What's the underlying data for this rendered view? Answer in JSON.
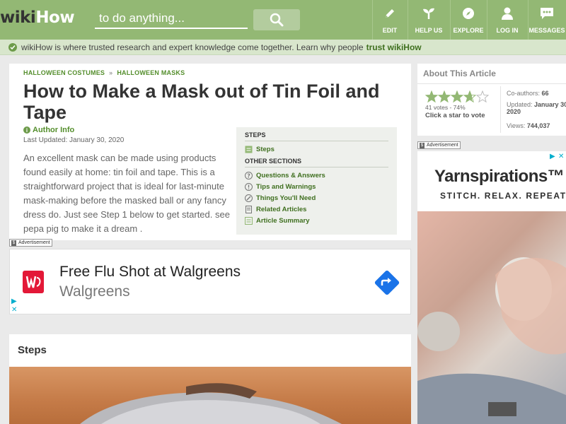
{
  "header": {
    "logo_wiki": "wiki",
    "logo_how": "How",
    "search_placeholder": "to do anything...",
    "nav": [
      {
        "label": "EDIT",
        "icon": "pencil-icon"
      },
      {
        "label": "HELP US",
        "icon": "sprout-icon"
      },
      {
        "label": "EXPLORE",
        "icon": "compass-icon"
      },
      {
        "label": "LOG IN",
        "icon": "user-icon"
      },
      {
        "label": "MESSAGES",
        "icon": "chat-icon"
      }
    ],
    "colors": {
      "bar": "#93b874",
      "search_button": "#b3cc9e"
    }
  },
  "trust_banner": {
    "text": "wikiHow is where trusted research and expert knowledge come together. Learn why people",
    "link": "trust wikiHow"
  },
  "article": {
    "breadcrumbs": [
      "HALLOWEEN COSTUMES",
      "HALLOWEEN MASKS"
    ],
    "breadcrumb_sep": "»",
    "title": "How to Make a Mask out of Tin Foil and Tape",
    "author_label": "Author Info",
    "last_updated": "Last Updated: January 30, 2020",
    "intro": "An excellent mask can be made using products found easily at home: tin foil and tape. This is a straightforward project that is ideal for last-minute mask-making before the masked ball or any fancy dress do. Just see Step 1 below to get started. see pepa pig to make it a dream ."
  },
  "toc": {
    "steps_heading": "STEPS",
    "steps_items": [
      {
        "label": "Steps",
        "icon": "list-icon"
      }
    ],
    "other_heading": "OTHER SECTIONS",
    "other_items": [
      {
        "label": "Questions & Answers",
        "icon": "question-icon"
      },
      {
        "label": "Tips and Warnings",
        "icon": "warning-icon"
      },
      {
        "label": "Things You'll Need",
        "icon": "tools-icon"
      },
      {
        "label": "Related Articles",
        "icon": "document-icon"
      },
      {
        "label": "Article Summary",
        "icon": "summary-icon"
      }
    ]
  },
  "ads": {
    "badge": "Advertisement",
    "flu": {
      "title": "Free Flu Shot at Walgreens",
      "sponsor": "Walgreens",
      "brand_color": "#e31837",
      "arrow_color": "#1a73e8"
    },
    "yarn": {
      "logo": "Yarnspirations™",
      "tagline": "STITCH. RELAX. REPEAT."
    }
  },
  "steps_section": {
    "title": "Steps"
  },
  "about": {
    "title": "About This Article",
    "rating_percent": 74,
    "votes": "41 votes - 74%",
    "click_prompt": "Click a star to vote",
    "coauthors_label": "Co-authors:",
    "coauthors_value": "66",
    "updated_label": "Updated:",
    "updated_value": "January 30",
    "updated_year": "2020",
    "views_label": "Views:",
    "views_value": "744,037",
    "star_color": "#93b874"
  }
}
